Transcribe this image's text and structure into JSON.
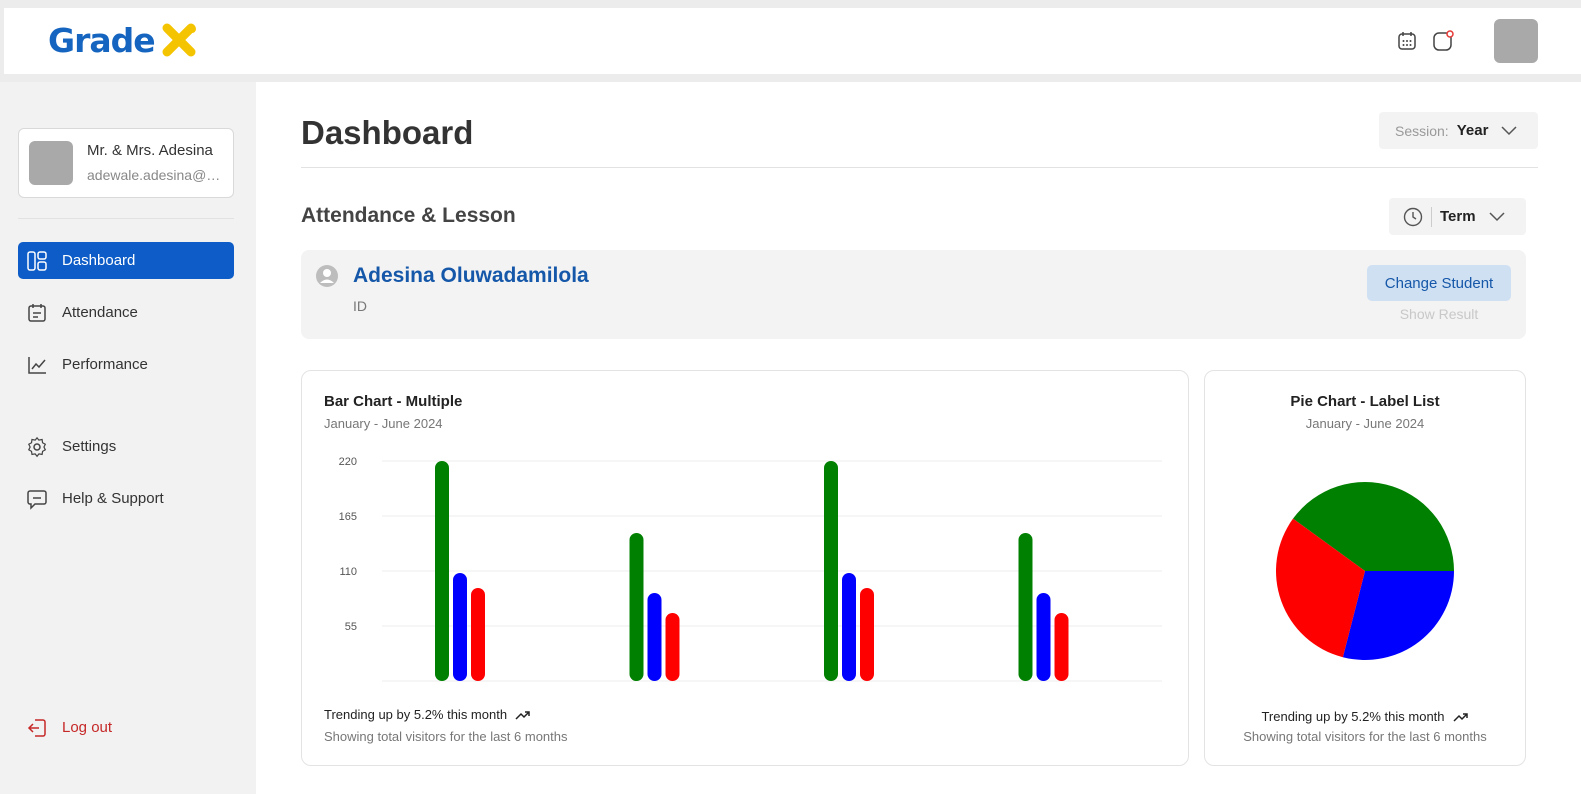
{
  "app": {
    "logo_text": "Grade",
    "logo_colors": {
      "text": "#1565c0",
      "mark": "#f5c400"
    }
  },
  "sidebar": {
    "profile": {
      "name": "Mr. & Mrs. Adesina",
      "email": "adewale.adesina@gmail.com"
    },
    "items": [
      {
        "label": "Dashboard",
        "icon": "layout-icon",
        "active": true
      },
      {
        "label": "Attendance",
        "icon": "calendar-check-icon",
        "active": false
      },
      {
        "label": "Performance",
        "icon": "chart-line-icon",
        "active": false
      },
      {
        "label": "Settings",
        "icon": "gear-icon",
        "active": false
      },
      {
        "label": "Help & Support",
        "icon": "message-icon",
        "active": false
      }
    ],
    "logout_label": "Log out"
  },
  "header": {
    "title": "Dashboard",
    "session_label": "Session:",
    "session_value": "Year"
  },
  "section": {
    "title": "Attendance & Lesson",
    "term_value": "Term"
  },
  "student": {
    "name": "Adesina Oluwadamilola",
    "id_label": "ID",
    "change_button": "Change Student",
    "show_result": "Show Result"
  },
  "bar_card": {
    "title": "Bar Chart - Multiple",
    "subtitle": "January - June 2024",
    "footer_trend": "Trending up by 5.2% this month",
    "footer_note": "Showing total visitors for the last 6 months"
  },
  "pie_card": {
    "title": "Pie Chart - Label List",
    "subtitle": "January - June 2024",
    "footer_trend": "Trending up by 5.2% this month",
    "footer_note": "Showing total visitors for the last 6 months"
  },
  "colors": {
    "accent": "#0d5cc7",
    "green": "#008000",
    "blue": "#0000ff",
    "red": "#ff0000",
    "logout": "#c62828"
  },
  "chart_data": [
    {
      "type": "bar",
      "title": "Bar Chart - Multiple",
      "subtitle": "January - June 2024",
      "categories": [
        "",
        "",
        "",
        ""
      ],
      "series": [
        {
          "color": "#008000",
          "values": [
            220,
            148,
            220,
            148
          ]
        },
        {
          "color": "#0000ff",
          "values": [
            108,
            88,
            108,
            88
          ]
        },
        {
          "color": "#ff0000",
          "values": [
            93,
            68,
            93,
            68
          ]
        }
      ],
      "yticks": [
        220,
        165,
        110,
        55
      ],
      "ylim": [
        0,
        220
      ],
      "grid": true
    },
    {
      "type": "pie",
      "title": "Pie Chart - Label List",
      "subtitle": "January - June 2024",
      "slices": [
        {
          "color": "#008000",
          "value": 40
        },
        {
          "color": "#0000ff",
          "value": 29
        },
        {
          "color": "#ff0000",
          "value": 31
        }
      ]
    }
  ]
}
